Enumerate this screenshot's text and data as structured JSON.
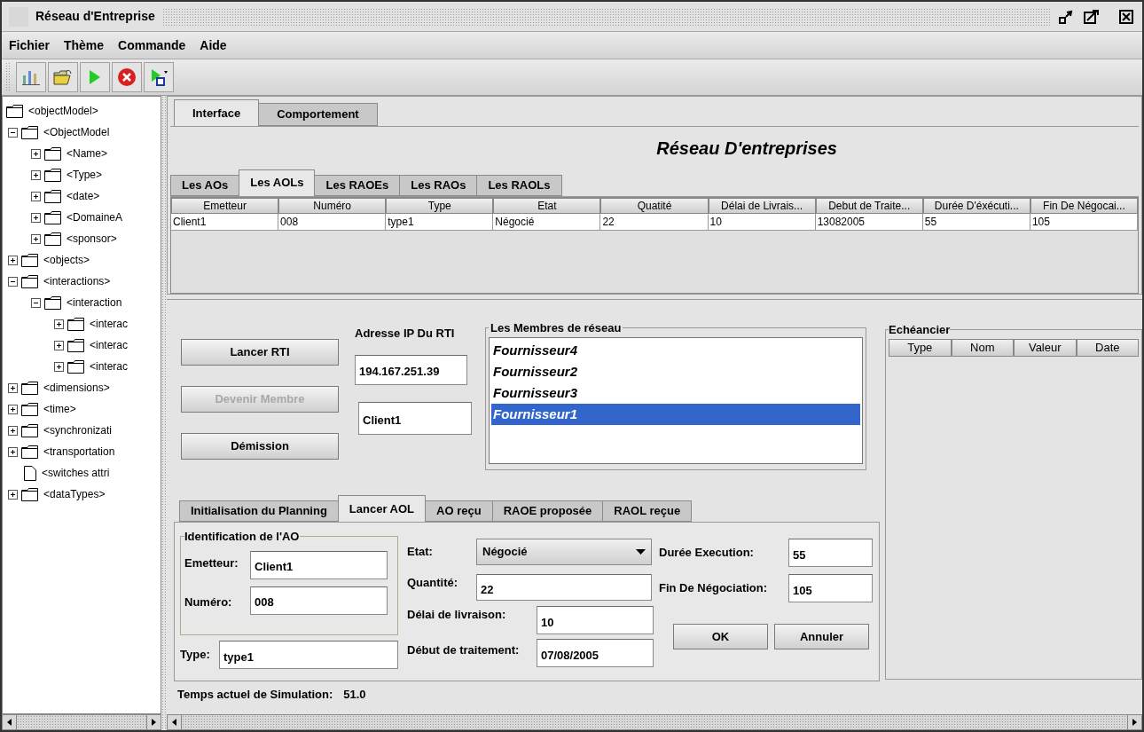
{
  "window": {
    "title": "Réseau d'Entreprise"
  },
  "menu": [
    {
      "label": "Fichier"
    },
    {
      "label": "Thème"
    },
    {
      "label": "Commande"
    },
    {
      "label": "Aide"
    }
  ],
  "tree": [
    {
      "label": "<objectModel>",
      "kind": "folder",
      "children": [
        {
          "label": "<ObjectModel",
          "kind": "folder",
          "expanded": true,
          "children": [
            {
              "label": "<Name>",
              "kind": "folder",
              "expanded": false
            },
            {
              "label": "<Type>",
              "kind": "folder",
              "expanded": false
            },
            {
              "label": "<date>",
              "kind": "folder",
              "expanded": false
            },
            {
              "label": "<DomaineA",
              "kind": "folder",
              "expanded": false
            },
            {
              "label": "<sponsor>",
              "kind": "folder",
              "expanded": false
            }
          ]
        },
        {
          "label": "<objects>",
          "kind": "folder",
          "expanded": false
        },
        {
          "label": "<interactions>",
          "kind": "folder",
          "expanded": true,
          "children": [
            {
              "label": "<interaction",
              "kind": "folder",
              "expanded": true,
              "children": [
                {
                  "label": "<interac",
                  "kind": "folder",
                  "expanded": false
                },
                {
                  "label": "<interac",
                  "kind": "folder",
                  "expanded": false
                },
                {
                  "label": "<interac",
                  "kind": "folder",
                  "expanded": false
                }
              ]
            }
          ]
        },
        {
          "label": "<dimensions>",
          "kind": "folder",
          "expanded": false
        },
        {
          "label": "<time>",
          "kind": "folder",
          "expanded": false
        },
        {
          "label": "<synchronizati",
          "kind": "folder",
          "expanded": false
        },
        {
          "label": "<transportation",
          "kind": "folder",
          "expanded": false
        },
        {
          "label": "<switches attri",
          "kind": "file"
        },
        {
          "label": "<dataTypes>",
          "kind": "folder",
          "expanded": false
        }
      ]
    }
  ],
  "main_tabs": [
    {
      "label": "Interface",
      "selected": true
    },
    {
      "label": "Comportement",
      "selected": false
    }
  ],
  "heading": "Réseau D'entreprises",
  "sub_tabs": [
    {
      "label": "Les AOs",
      "selected": false
    },
    {
      "label": "Les AOLs",
      "selected": true
    },
    {
      "label": "Les RAOEs",
      "selected": false
    },
    {
      "label": "Les RAOs",
      "selected": false
    },
    {
      "label": "Les RAOLs",
      "selected": false
    }
  ],
  "table": {
    "columns": [
      "Emetteur",
      "Numéro",
      "Type",
      "Etat",
      "Quatité",
      "Délai de Livrais...",
      "Debut de Traite...",
      "Durée D'éxécuti...",
      "Fin De Négocai..."
    ],
    "rows": [
      [
        "Client1",
        "008",
        "type1",
        "Négocié",
        "22",
        "10",
        "13082005",
        "55",
        "105"
      ]
    ]
  },
  "controls": {
    "buttons": [
      {
        "label": "Lancer RTI",
        "disabled": false
      },
      {
        "label": "Devenir Membre",
        "disabled": true
      },
      {
        "label": "Démission",
        "disabled": false
      }
    ],
    "ip_label": "Adresse IP Du RTI",
    "ip_value": "194.167.251.39",
    "name_value": "Client1"
  },
  "members": {
    "title": "Les Membres de réseau",
    "items": [
      {
        "label": "Fournisseur4",
        "selected": false
      },
      {
        "label": "Fournisseur2",
        "selected": false
      },
      {
        "label": "Fournisseur3",
        "selected": false
      },
      {
        "label": "Fournisseur1",
        "selected": true
      }
    ]
  },
  "schedule": {
    "title": "Echéancier",
    "columns": [
      "Type",
      "Nom",
      "Valeur",
      "Date"
    ]
  },
  "form_tabs": [
    {
      "label": "Initialisation du Planning",
      "selected": false
    },
    {
      "label": "Lancer AOL",
      "selected": true
    },
    {
      "label": "AO reçu",
      "selected": false
    },
    {
      "label": "RAOE proposée",
      "selected": false
    },
    {
      "label": "RAOL reçue",
      "selected": false
    }
  ],
  "form": {
    "group_title": "Identification de l'AO",
    "emitter": {
      "label": "Emetteur:",
      "value": "Client1"
    },
    "number": {
      "label": "Numéro:",
      "value": "008"
    },
    "type": {
      "label": "Type:",
      "value": "type1"
    },
    "state": {
      "label": "Etat:",
      "value": "Négocié"
    },
    "quantity": {
      "label": "Quantité:",
      "value": "22"
    },
    "delivery": {
      "label": "Délai de livraison:",
      "value": "10"
    },
    "start": {
      "label": "Début de traitement:",
      "value": "07/08/2005"
    },
    "duration": {
      "label": "Durée Execution:",
      "value": "55"
    },
    "negotiation_end": {
      "label": "Fin De Négociation:",
      "value": "105"
    },
    "buttons": [
      "OK",
      "Annuler"
    ]
  },
  "status": {
    "label": "Temps actuel de Simulation:",
    "value": "51.0"
  }
}
